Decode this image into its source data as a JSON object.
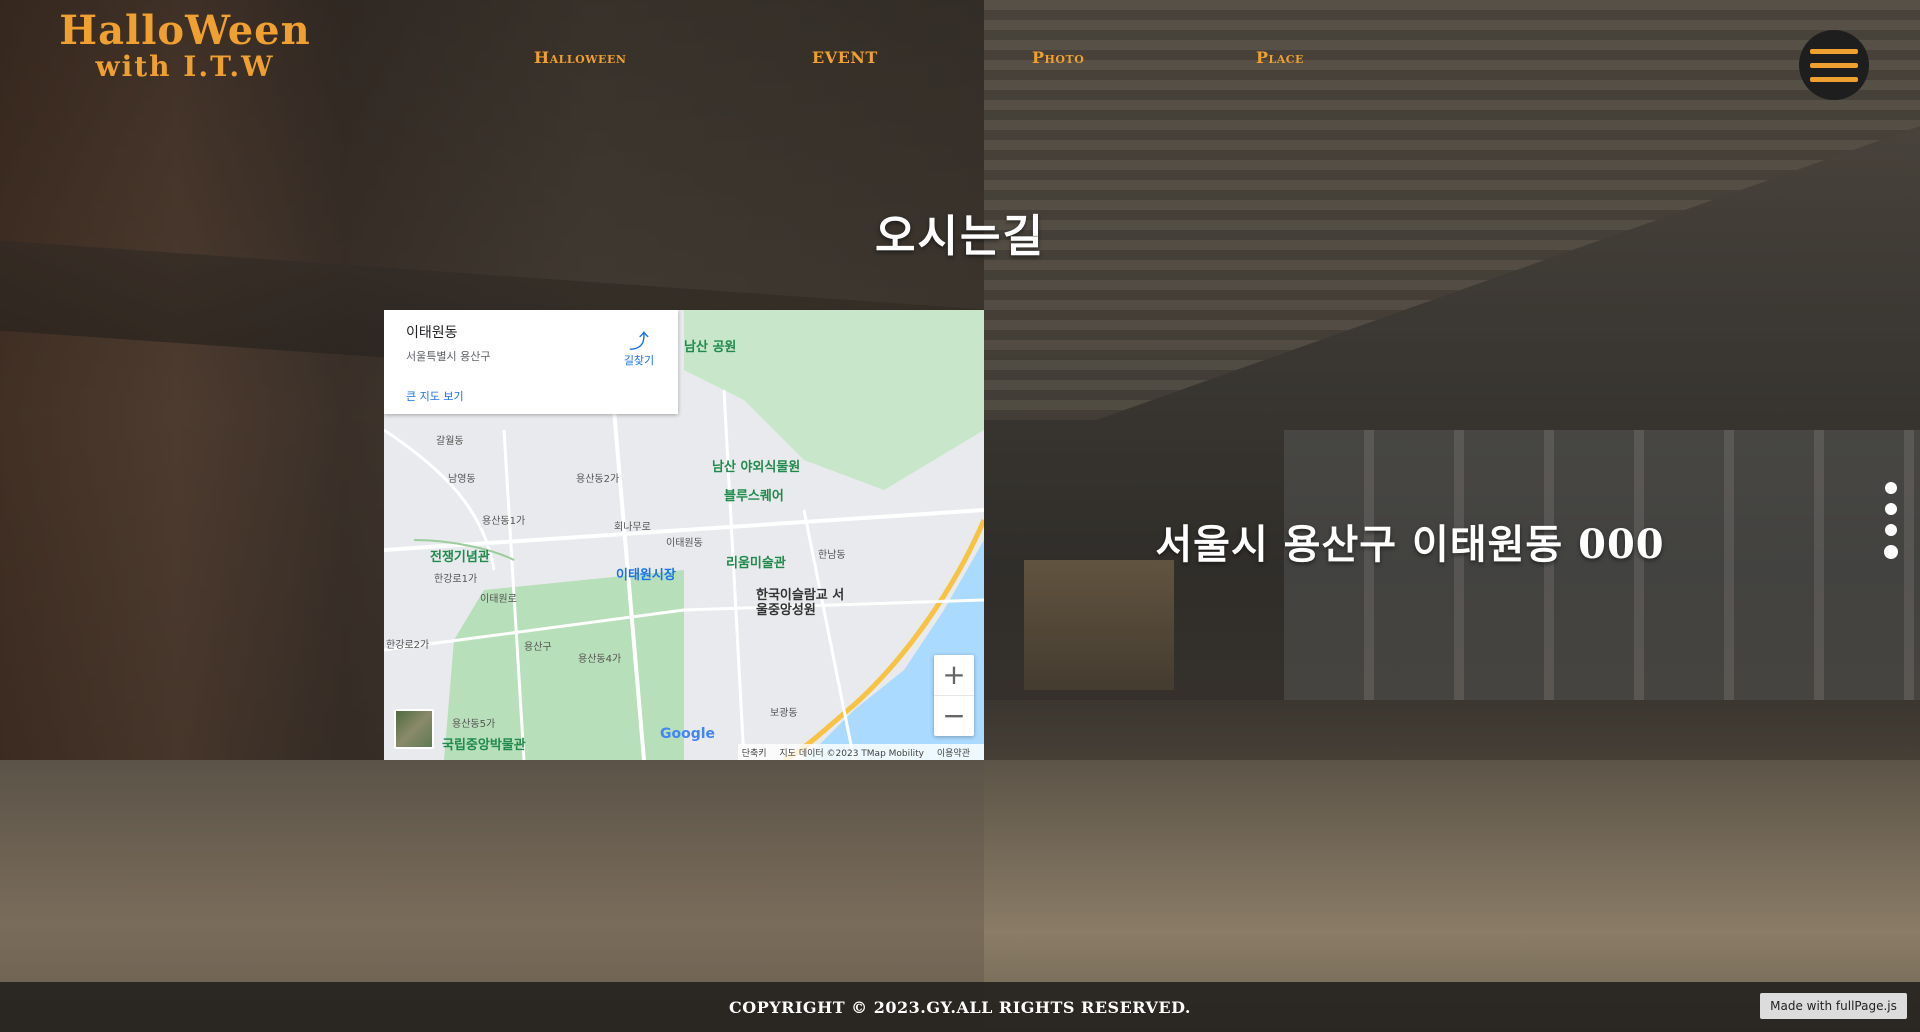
{
  "header": {
    "logo_line1": "HalloWeen",
    "logo_line2": "with I.T.W",
    "nav": [
      "Halloween",
      "EVENT",
      "Photo",
      "Place"
    ],
    "accent": "#f0a030"
  },
  "section": {
    "title": "오시는길",
    "address": "서울시 용산구 이태원동 000"
  },
  "map": {
    "place_name": "이태원동",
    "place_address": "서울특별시 용산구",
    "directions_label": "길찾기",
    "larger_map_label": "큰 지도 보기",
    "zoom_in": "+",
    "zoom_out": "−",
    "google": "Google",
    "attr_shortcuts": "단축키",
    "attr_data": "지도 데이터 ©2023 TMap Mobility",
    "attr_terms": "이용약관",
    "labels": {
      "namsan_park": "남산 공원",
      "namsan_garden": "남산 야외식물원",
      "blue_square": "블루스퀘어",
      "leeum": "리움미술관",
      "war_memorial": "전쟁기념관",
      "itaewon_market": "이태원시장",
      "islamic_school": "한국이슬람교 서울중앙성원",
      "national_museum": "국립중앙박물관",
      "itaewon_dong": "이태원동",
      "yongsan_gu": "용산구",
      "galwol": "갈월동",
      "namyeong": "남영동",
      "yongsan_2": "용산동2가",
      "yongsan_1": "용산동1가",
      "hannam": "한남동",
      "hangangro1": "한강로1가",
      "hangangro2": "한강로2가",
      "yongsan_4": "용산동4가",
      "yongsan_5": "용산동5가",
      "bogwang": "보광동",
      "itaewonro": "이태원로",
      "hoenamuro": "회나무로"
    }
  },
  "pagination": {
    "count": 4,
    "active_index": 3
  },
  "footer": {
    "copyright": "COPYRIGHT © 2023.GY.ALL RIGHTS RESERVED.",
    "made_with": "Made with fullPage.js"
  }
}
